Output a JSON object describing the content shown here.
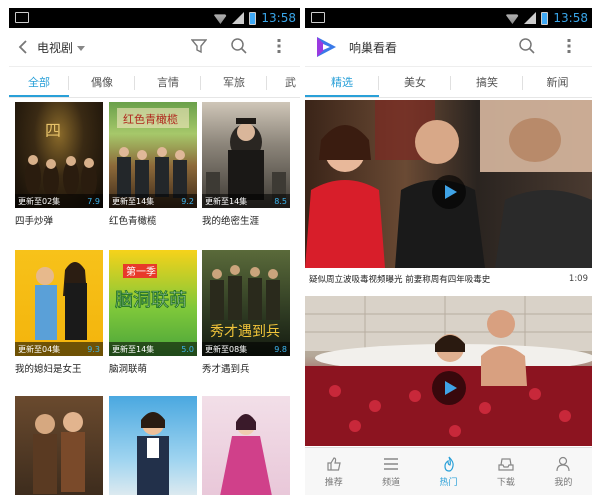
{
  "status_time": "13:58",
  "left": {
    "title": "电视剧",
    "tabs": [
      "全部",
      "偶像",
      "言情",
      "军旅",
      "武"
    ],
    "items": [
      {
        "label": "四手炒弹",
        "update": "更新至02集",
        "score": "7.9"
      },
      {
        "label": "红色青橄榄",
        "update": "更新至14集",
        "score": "9.2"
      },
      {
        "label": "我的绝密生涯",
        "update": "更新至14集",
        "score": "8.5"
      },
      {
        "label": "我的媳妇是女王",
        "update": "更新至04集",
        "score": "9.3"
      },
      {
        "label": "脑洞联萌",
        "update": "更新至14集",
        "score": "5.0"
      },
      {
        "label": "秀才遇到兵",
        "update": "更新至08集",
        "score": "9.8"
      },
      {
        "label": "",
        "update": "",
        "score": ""
      },
      {
        "label": "",
        "update": "",
        "score": ""
      },
      {
        "label": "",
        "update": "",
        "score": ""
      }
    ],
    "poster_texts": [
      "第一季",
      "脑洞联萌",
      "秀才遇到兵",
      "红色青橄榄"
    ]
  },
  "right": {
    "app_name": "响巢看看",
    "tabs": [
      "精选",
      "美女",
      "搞笑",
      "新闻"
    ],
    "videos": [
      {
        "title": "疑似周立波吸毒视频曝光 前妻称周有四年吸毒史",
        "duration": "1:09"
      }
    ],
    "nav": [
      "推荐",
      "频道",
      "热门",
      "下载",
      "我的"
    ],
    "active_nav": "热门"
  },
  "colors": {
    "accent": "#2aa0d8",
    "status_time": "#39a5e8"
  }
}
